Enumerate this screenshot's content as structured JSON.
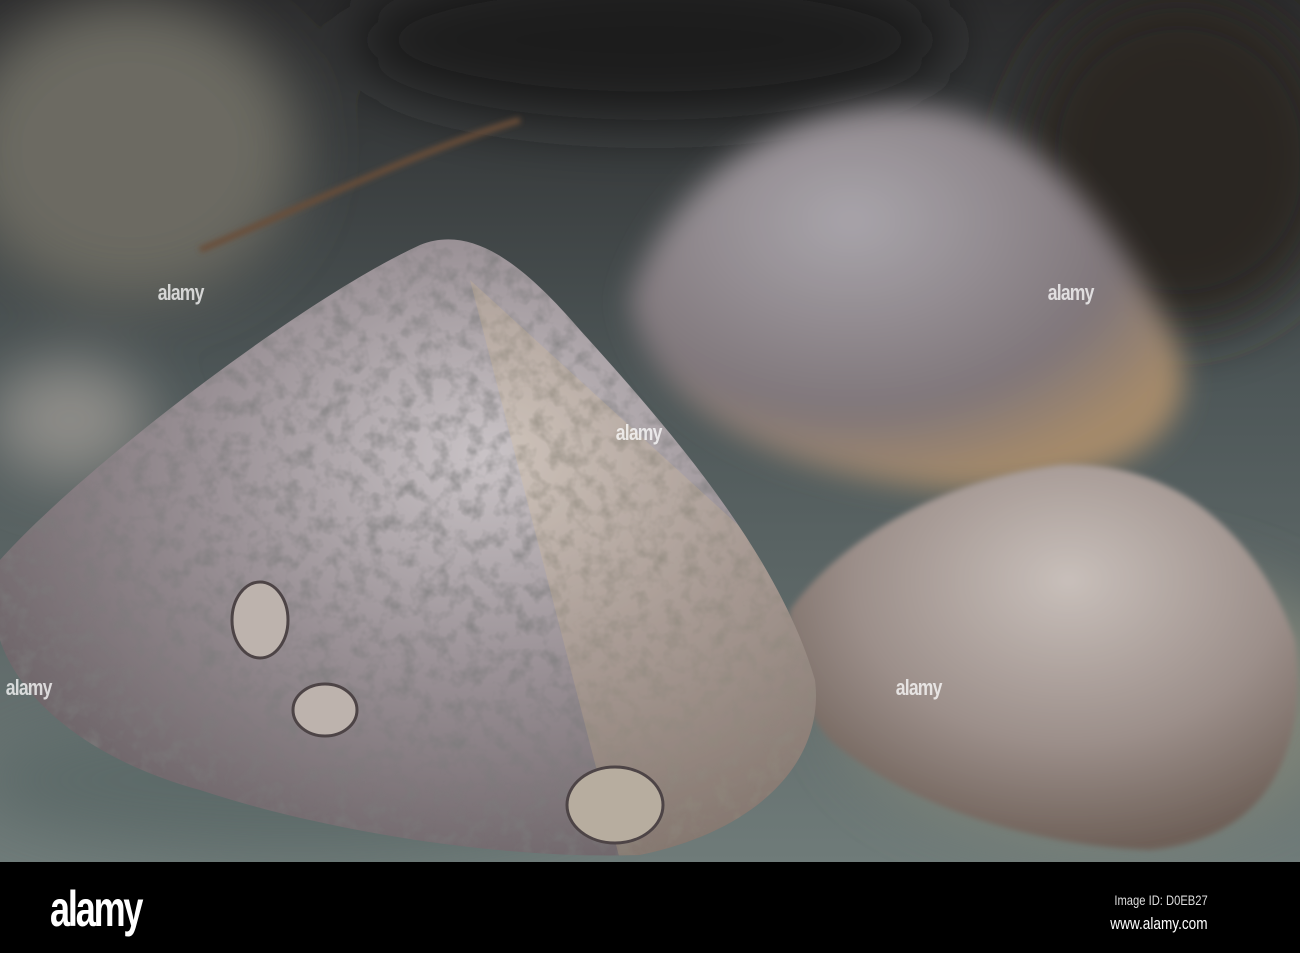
{
  "photo": {
    "subject": "limpet-shells-on-rock",
    "colors": {
      "background_dark": "#2a2c2e",
      "rock": "#6f7a78",
      "shell_light": "#c9c2c4",
      "shell_shadow": "#5d5457",
      "sunlight": "#e8c98a"
    }
  },
  "watermark": {
    "text": "alamy"
  },
  "footer": {
    "logo": "alamy",
    "image_id": "Image ID: D0EB27",
    "url": "www.alamy.com"
  }
}
